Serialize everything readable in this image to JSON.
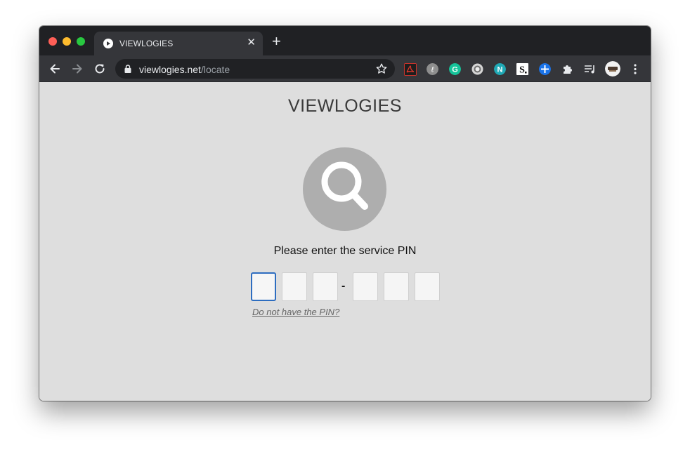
{
  "window": {
    "tab": {
      "title": "VIEWLOGIES"
    }
  },
  "toolbar": {
    "url_host": "viewlogies.net",
    "url_path": "/locate",
    "extensions": [
      {
        "name": "acrobat-extension-icon",
        "color": "#c9332b"
      },
      {
        "name": "edge-extension-icon",
        "color": "#8e8e8e"
      },
      {
        "name": "grammarly-extension-icon",
        "color": "#15c39a"
      },
      {
        "name": "circle-extension-icon",
        "color": "#d6d6d6"
      },
      {
        "name": "n-extension-icon",
        "color": "#1fa9b5"
      },
      {
        "name": "s-extension-icon",
        "color": "#ffffff"
      },
      {
        "name": "plus-extension-icon",
        "color": "#1a73e8"
      }
    ]
  },
  "page": {
    "brand": "VIEWLOGIES",
    "prompt": "Please enter the service PIN",
    "pin_separator": "-",
    "no_pin_link": "Do not have the PIN?"
  },
  "colors": {
    "accent": "#2d6dc0",
    "page_bg": "#dedede",
    "icon_circle": "#aeaeae"
  }
}
